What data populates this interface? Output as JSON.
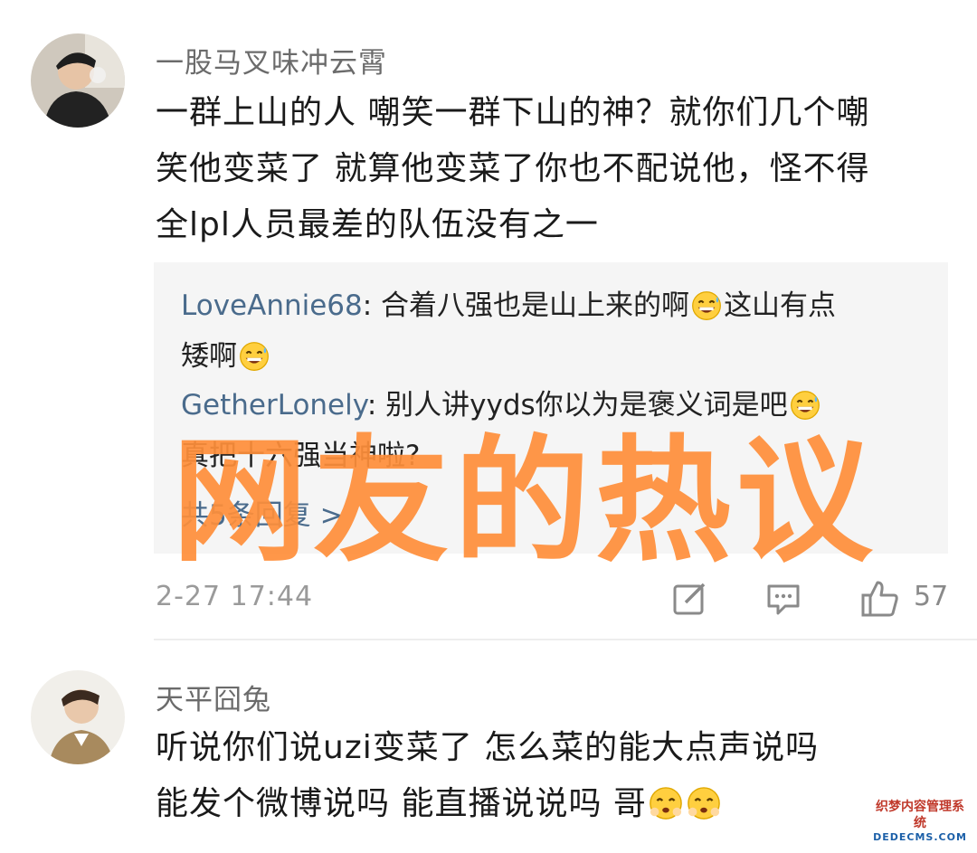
{
  "comments": [
    {
      "username": "一股马叉味冲云霄",
      "content_lines": [
        "一群上山的人 嘲笑一群下山的神？就你们几个嘲",
        "笑他变菜了  就算他变菜了你也不配说他，怪不得",
        "全lpl人员最差的队伍没有之一"
      ],
      "replies": [
        {
          "name": "LoveAnnie68",
          "text1": ": 合着八强也是山上来的啊",
          "text2": "这山有点",
          "text3": "矮啊"
        },
        {
          "name": "GetherLonely",
          "text1": ": 别人讲yyds你以为是褒义词是吧",
          "text2": "真把十六强当神啦?"
        }
      ],
      "view_all_replies": "共5条回复 >",
      "time": "2-27 17:44",
      "like_count": "57"
    },
    {
      "username": "天平囧兔",
      "content_lines": [
        "听说你们说uzi变菜了  怎么菜的能大点声说吗",
        "能发个微博说吗  能直播说说吗  哥"
      ]
    }
  ],
  "overlay_text": "网友的热议",
  "watermark": {
    "line1": "织梦内容管理系统",
    "line2": "DEDECMS.COM"
  },
  "icons": {
    "emoji_sweat": "sweat-smile-emoji",
    "emoji_blush": "blush-emoji",
    "share": "share-edit-icon",
    "comment": "comment-icon",
    "like": "thumbs-up-icon"
  },
  "colors": {
    "reply_name": "#4a6b8c",
    "overlay": "#ff8f3a",
    "meta": "#9a9a9a"
  }
}
